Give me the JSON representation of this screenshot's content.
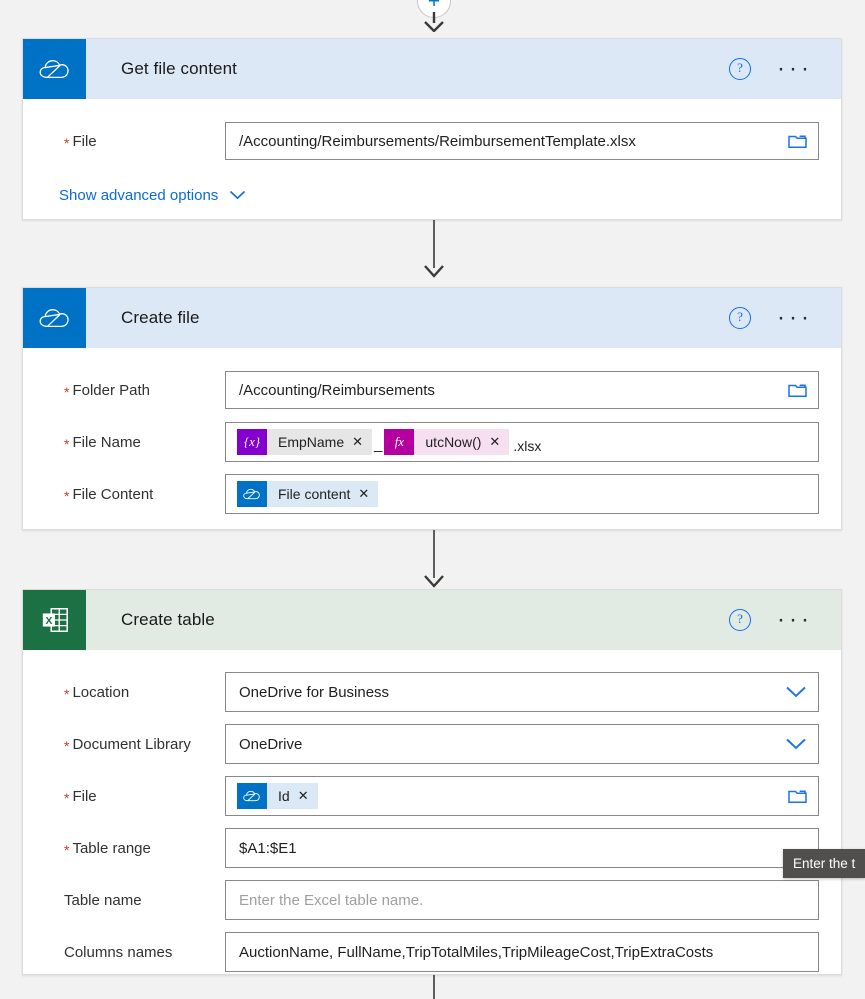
{
  "flow": {
    "add_step_label": "+",
    "tooltip": {
      "text": "Enter the t"
    },
    "cards": [
      {
        "id": "get-file-content",
        "title": "Get file content",
        "connector": "onedrive",
        "theme": "blue",
        "help_label": "?",
        "menu_label": "···",
        "fields": [
          {
            "label": "File",
            "required": true,
            "type": "text",
            "value": "/Accounting/Reimbursements/ReimbursementTemplate.xlsx",
            "adorn": "folder-icon"
          }
        ],
        "advanced_link": "Show advanced options"
      },
      {
        "id": "create-file",
        "title": "Create file",
        "connector": "onedrive",
        "theme": "blue",
        "help_label": "?",
        "menu_label": "···",
        "fields": [
          {
            "label": "Folder Path",
            "required": true,
            "type": "text",
            "value": "/Accounting/Reimbursements",
            "adorn": "folder-icon"
          },
          {
            "label": "File Name",
            "required": true,
            "type": "tokens",
            "tokens": [
              {
                "kind": "variable",
                "icon": "{x}",
                "text": "EmpName",
                "remove": "✕"
              },
              {
                "kind": "separator",
                "text": "_"
              },
              {
                "kind": "expression",
                "icon": "fx",
                "text": "utcNow()",
                "remove": "✕"
              },
              {
                "kind": "tail",
                "text": ".xlsx"
              }
            ]
          },
          {
            "label": "File Content",
            "required": true,
            "type": "tokens",
            "tokens": [
              {
                "kind": "onedrive",
                "icon": "onedrive-icon",
                "text": "File content",
                "remove": "✕"
              }
            ]
          }
        ]
      },
      {
        "id": "create-table",
        "title": "Create table",
        "connector": "excel",
        "theme": "green",
        "help_label": "?",
        "menu_label": "···",
        "fields": [
          {
            "label": "Location",
            "required": true,
            "type": "select",
            "value": "OneDrive for Business",
            "adorn": "chevron-down-icon"
          },
          {
            "label": "Document Library",
            "required": true,
            "type": "select",
            "value": "OneDrive",
            "adorn": "chevron-down-icon"
          },
          {
            "label": "File",
            "required": true,
            "type": "tokens",
            "adorn": "folder-icon",
            "tokens": [
              {
                "kind": "onedrive",
                "icon": "onedrive-icon",
                "text": "Id",
                "remove": "✕"
              }
            ]
          },
          {
            "label": "Table range",
            "required": true,
            "type": "text",
            "value": "$A1:$E1"
          },
          {
            "label": "Table name",
            "required": false,
            "type": "text",
            "value": "",
            "placeholder": "Enter the Excel table name."
          },
          {
            "label": "Columns names",
            "required": false,
            "type": "text",
            "value": "AuctionName, FullName,TripTotalMiles,TripMileageCost,TripExtraCosts"
          }
        ]
      }
    ]
  },
  "colors": {
    "onedrive_blue": "#0072c6",
    "excel_green": "#1b7044",
    "header_blue": "#dde8f7",
    "header_green": "#e1ebe3",
    "link_blue": "#0b6bd3",
    "required_red": "#d6372b",
    "variable_purple": "#8400cc",
    "expression_magenta": "#b4009e"
  }
}
